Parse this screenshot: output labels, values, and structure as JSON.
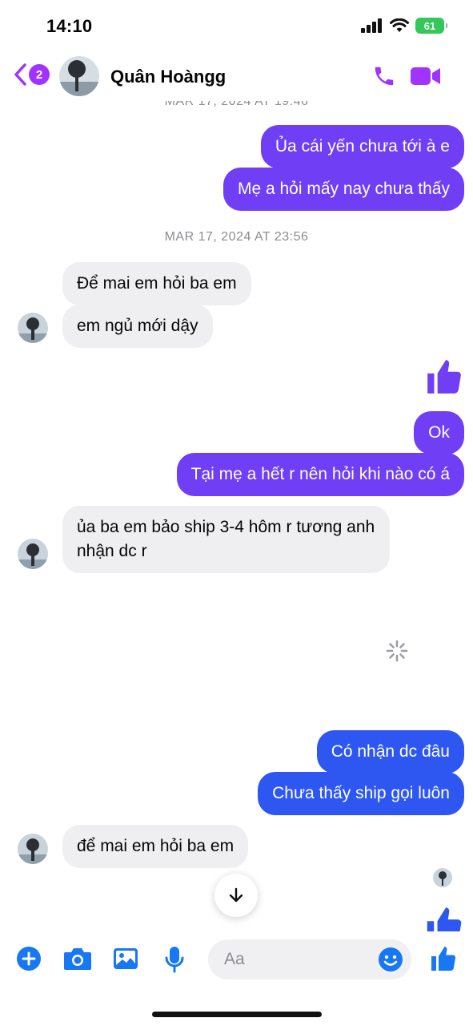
{
  "status_bar": {
    "time": "14:10",
    "battery": "61"
  },
  "header": {
    "back_badge": "2",
    "contact_name": "Quân Hoàngg"
  },
  "timestamps": [
    "MAR 17, 2024 AT 19:46",
    "MAR 17, 2024 AT 23:56"
  ],
  "messages": {
    "m1": "Ủa cái yến chưa tới à e",
    "m2": "Mẹ a hỏi mấy nay chưa thấy",
    "m3": "Để mai em hỏi ba em",
    "m4": "em ngủ mới dậy",
    "m5": "Ok",
    "m6": "Tại mẹ a hết r nên hỏi khi nào có á",
    "m7": "ủa ba em bảo ship 3-4 hôm r tương anh nhận dc r",
    "m8": "Có nhận dc đâu",
    "m9": "Chưa thấy ship gọi luôn",
    "m10": "để mai em hỏi ba em"
  },
  "composer": {
    "placeholder": "Aa"
  },
  "colors": {
    "accent": "#a033ff",
    "outgoing_purple": "#6f3ef5",
    "outgoing_blue": "#2d57f0",
    "incoming": "#efeff1",
    "composer_blue": "#1877f2"
  }
}
